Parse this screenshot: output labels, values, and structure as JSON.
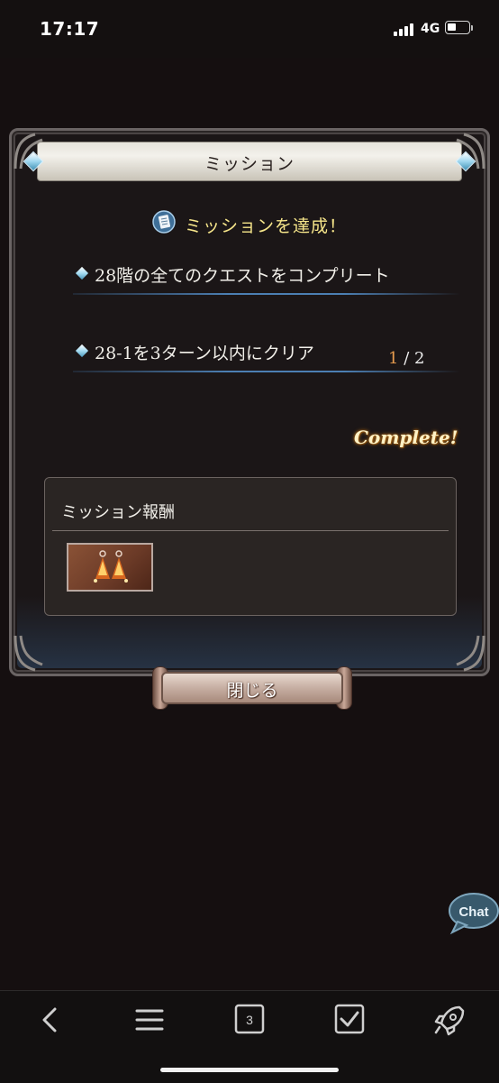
{
  "status": {
    "time": "17:17",
    "network": "4G"
  },
  "dialog": {
    "title": "ミッション",
    "achieved_text": "ミッションを達成！",
    "missions": [
      {
        "label": "28階の全てのクエストをコンプリート",
        "progress_current": "1",
        "progress_total": "/ 2"
      },
      {
        "label": "28-1を3ターン以内にクリア",
        "status": "Complete!"
      }
    ],
    "reward": {
      "title": "ミッション報酬"
    },
    "close_label": "閉じる"
  },
  "chat": {
    "label": "Chat"
  },
  "toolbar": {
    "tabs_count": "3"
  },
  "colors": {
    "achieved": "#f6e58a",
    "progress_current": "#e79c4e",
    "complete_glow": "#c0781c"
  }
}
